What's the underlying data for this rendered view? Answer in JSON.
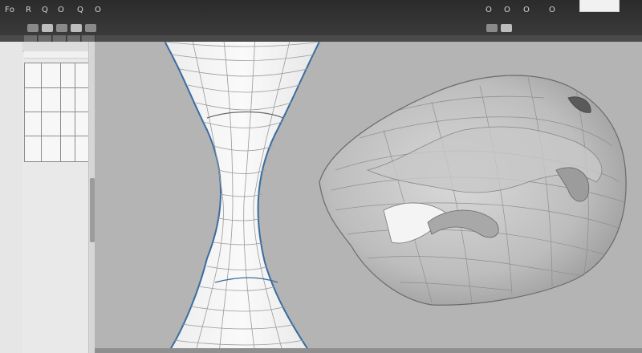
{
  "menu": {
    "items": [
      "Fo",
      "R",
      "Q",
      "O",
      "Q",
      "O"
    ],
    "right_items": [
      "O",
      "O",
      "O",
      "O"
    ]
  },
  "properties_panel": {
    "cells": [
      "",
      "",
      "",
      "",
      "",
      ""
    ]
  },
  "colors": {
    "topbar": "#2b2b2b",
    "viewport": "#b4b4b4",
    "model_edge": "#3a6ca0",
    "mesh": "#9a9a9a",
    "surface": "#f2f2f2"
  }
}
